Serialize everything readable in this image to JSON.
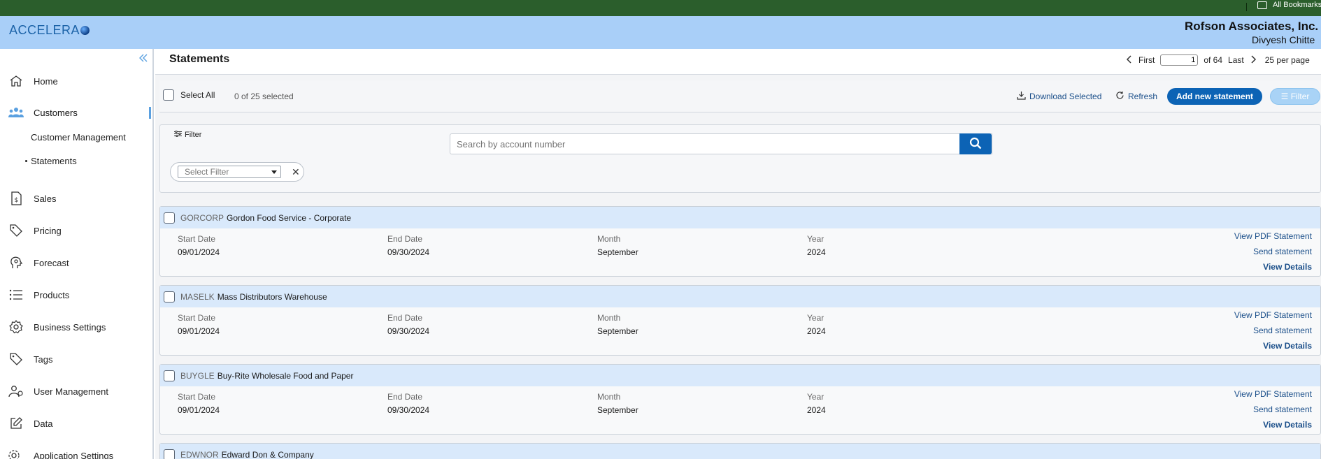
{
  "browser": {
    "bookmarks_label": "All Bookmarks"
  },
  "header": {
    "logo_text": "ACCELERA",
    "company": "Rofson Associates, Inc.",
    "user": "Divyesh Chitte"
  },
  "sidebar": {
    "items": [
      {
        "label": "Home",
        "icon": "home-icon"
      },
      {
        "label": "Customers",
        "icon": "customers-icon"
      },
      {
        "label": "Sales",
        "icon": "sales-icon"
      },
      {
        "label": "Pricing",
        "icon": "pricing-icon"
      },
      {
        "label": "Forecast",
        "icon": "forecast-icon"
      },
      {
        "label": "Products",
        "icon": "products-icon"
      },
      {
        "label": "Business Settings",
        "icon": "gear-icon"
      },
      {
        "label": "Tags",
        "icon": "tag-icon"
      },
      {
        "label": "User Management",
        "icon": "users-icon"
      },
      {
        "label": "Data",
        "icon": "edit-icon"
      },
      {
        "label": "Application Settings",
        "icon": "app-settings-icon"
      }
    ],
    "sub_items": [
      {
        "label": "Customer Management"
      },
      {
        "label": "Statements"
      }
    ],
    "accent_color": "#5aa0e0"
  },
  "page": {
    "title": "Statements",
    "pager": {
      "first": "First",
      "current_page": "1",
      "of_text": "of 64",
      "last": "Last",
      "per_page": "25 per page"
    }
  },
  "toolbar": {
    "select_all": "Select All",
    "selected_count": "0 of 25 selected",
    "download": "Download Selected",
    "refresh": "Refresh",
    "add_new": "Add new statement",
    "filter": "Filter"
  },
  "filter_panel": {
    "label": "Filter",
    "search_placeholder": "Search by account number",
    "select_placeholder": "Select Filter"
  },
  "labels": {
    "start_date": "Start Date",
    "end_date": "End Date",
    "month": "Month",
    "year": "Year",
    "view_pdf": "View PDF Statement",
    "send": "Send statement",
    "details": "View Details"
  },
  "statements": [
    {
      "code": "GORCORP",
      "name": "Gordon Food Service - Corporate",
      "start_date": "09/01/2024",
      "end_date": "09/30/2024",
      "month": "September",
      "year": "2024"
    },
    {
      "code": "MASELK",
      "name": "Mass Distributors Warehouse",
      "start_date": "09/01/2024",
      "end_date": "09/30/2024",
      "month": "September",
      "year": "2024"
    },
    {
      "code": "BUYGLE",
      "name": "Buy-Rite Wholesale Food and Paper",
      "start_date": "09/01/2024",
      "end_date": "09/30/2024",
      "month": "September",
      "year": "2024"
    },
    {
      "code": "EDWNOR",
      "name": "Edward Don & Company"
    }
  ],
  "colors": {
    "browser_bar": "#2b5e2c",
    "header": "#a9cff8",
    "primary": "#0c63b5",
    "card_head": "#d9e9fb"
  }
}
